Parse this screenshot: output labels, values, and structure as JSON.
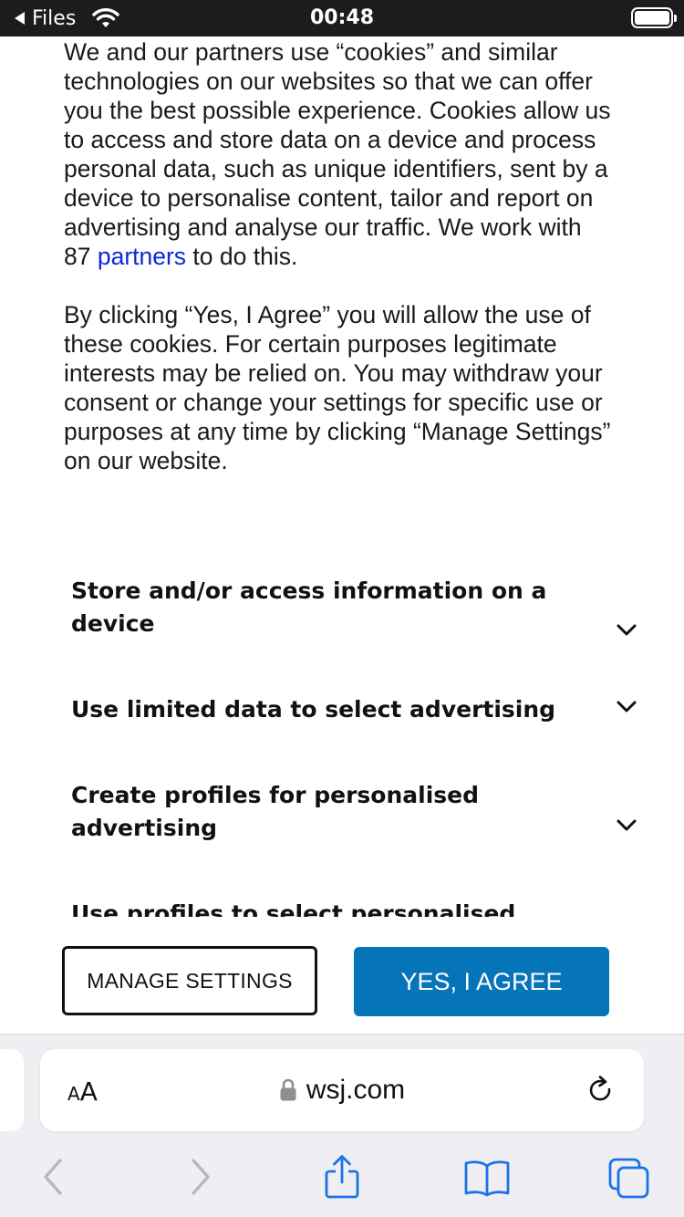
{
  "status_bar": {
    "back_label": "Files",
    "time": "00:48"
  },
  "consent": {
    "para1_before_link": "We and our partners use “cookies” and similar technologies on our websites so that we can offer you the best possible experience. Cookies allow us to access and store data on a device and process personal data, such as unique identifiers, sent by a device to personalise content, tailor and report on advertising and analyse our traffic. We work with 87 ",
    "para1_link": "partners",
    "para1_after_link": " to do this.",
    "para2": "By clicking “Yes, I Agree” you will allow the use of these cookies. For certain purposes legitimate interests may be relied on. You may withdraw your consent or change your settings for specific use or purposes at any time by clicking “Manage Settings” on our website."
  },
  "purposes": [
    {
      "label": "Store and/or access information on a device"
    },
    {
      "label": "Use limited data to select advertising"
    },
    {
      "label": "Create profiles for personalised advertising"
    },
    {
      "label": "Use profiles to select personalised advertising"
    }
  ],
  "buttons": {
    "manage_settings": "MANAGE SETTINGS",
    "agree": "YES, I AGREE"
  },
  "browser": {
    "text_size_small": "A",
    "text_size_big": "A",
    "url": "wsj.com",
    "icons": [
      "text-size-icon",
      "lock-icon",
      "reload-icon",
      "back-icon",
      "forward-icon",
      "share-icon",
      "bookmarks-icon",
      "tabs-icon"
    ]
  },
  "colors": {
    "agree_button": "#0574b9",
    "link": "#0a2adc",
    "status_bar_bg": "#1c1c1e",
    "toolbar_icon_active": "#1a73e8",
    "toolbar_icon_disabled": "#b5b5ba"
  }
}
